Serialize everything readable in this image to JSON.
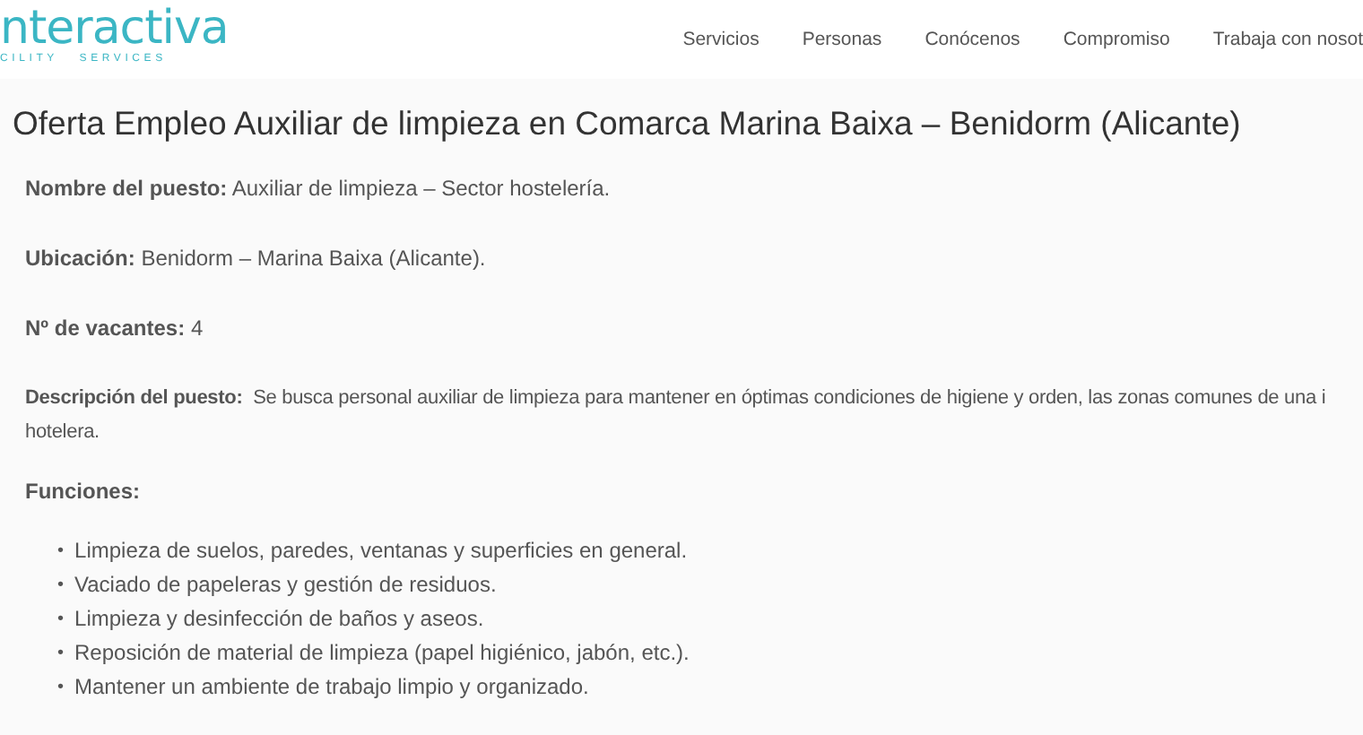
{
  "header": {
    "logo": {
      "name": "nteractiva",
      "tagline": "CILITY   SERVICES"
    },
    "nav": [
      {
        "label": "Servicios"
      },
      {
        "label": "Personas"
      },
      {
        "label": "Conócenos"
      },
      {
        "label": "Compromiso"
      },
      {
        "label": "Trabaja con nosot"
      }
    ]
  },
  "title": "Oferta Empleo Auxiliar de limpieza en Comarca Marina Baixa – Benidorm (Alicante)",
  "fields": [
    {
      "label": "Nombre del puesto:",
      "value": "Auxiliar de limpieza – Sector hostelería."
    },
    {
      "label": "Ubicación:",
      "value": "Benidorm – Marina Baixa (Alicante)."
    },
    {
      "label": "Nº de vacantes:",
      "value": "4"
    }
  ],
  "description": {
    "label": "Descripción del puesto:",
    "lines": [
      "Se busca personal auxiliar de limpieza para mantener en óptimas condiciones de higiene y orden, las zonas comunes de una i",
      "hotelera."
    ]
  },
  "functions": {
    "heading": "Funciones:",
    "marker": "•",
    "items": [
      "Limpieza de suelos, paredes, ventanas y superficies en general.",
      "Vaciado de papeleras y gestión de residuos.",
      "Limpieza y desinfección de baños y aseos.",
      "Reposición de material de limpieza (papel higiénico, jabón, etc.).",
      "Mantener un ambiente de trabajo limpio y organizado."
    ]
  }
}
